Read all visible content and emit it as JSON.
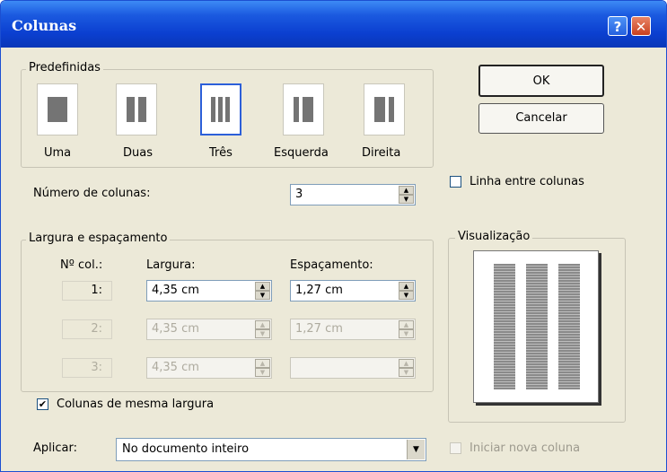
{
  "window": {
    "title": "Colunas",
    "help_glyph": "?",
    "close_glyph": "✕"
  },
  "presets": {
    "legend": "Predefinidas",
    "items": [
      {
        "label": "Uma",
        "icon": "one-column-icon"
      },
      {
        "label": "Duas",
        "icon": "two-columns-icon"
      },
      {
        "label": "Três",
        "icon": "three-columns-icon",
        "selected": true
      },
      {
        "label": "Esquerda",
        "icon": "left-column-icon"
      },
      {
        "label": "Direita",
        "icon": "right-column-icon"
      }
    ]
  },
  "buttons": {
    "ok": "OK",
    "cancel": "Cancelar"
  },
  "line_between": {
    "label": "Linha entre colunas",
    "checked": false
  },
  "num_columns": {
    "label": "Número de colunas:",
    "value": "3"
  },
  "width_spacing": {
    "legend": "Largura e espaçamento",
    "headers": {
      "col": "Nº col.:",
      "width": "Largura:",
      "spacing": "Espaçamento:"
    },
    "rows": [
      {
        "col": "1:",
        "width": "4,35 cm",
        "spacing": "1,27 cm",
        "enabled": true
      },
      {
        "col": "2:",
        "width": "4,35 cm",
        "spacing": "1,27 cm",
        "enabled": false
      },
      {
        "col": "3:",
        "width": "4,35 cm",
        "spacing": "",
        "enabled": false
      }
    ],
    "equal_width": {
      "label": "Colunas de mesma largura",
      "checked": true
    }
  },
  "preview": {
    "legend": "Visualização",
    "columns": 3
  },
  "apply": {
    "label": "Aplicar:",
    "value": "No documento inteiro"
  },
  "new_column": {
    "label": "Iniciar nova coluna",
    "checked": false,
    "enabled": false
  },
  "colors": {
    "title_bar": "#0b3fd0",
    "dialog_bg": "#ece9d8",
    "selection_border": "#2c5fd9"
  }
}
